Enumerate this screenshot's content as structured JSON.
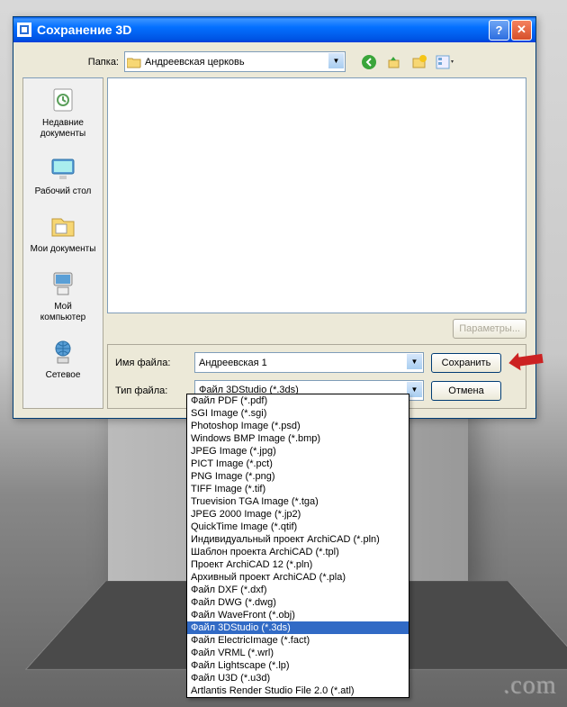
{
  "title": "Сохранение 3D",
  "folder_label": "Папка:",
  "folder_value": "Андреевская церковь",
  "places": [
    {
      "label": "Недавние документы"
    },
    {
      "label": "Рабочий стол"
    },
    {
      "label": "Мои документы"
    },
    {
      "label": "Мой\nкомпьютер"
    },
    {
      "label": "Сетевое"
    }
  ],
  "params_btn": "Параметры...",
  "filename_label": "Имя файла:",
  "filename_value": "Андреевская 1",
  "filetype_label": "Тип файла:",
  "filetype_value": "Файл 3DStudio (*.3ds)",
  "save_btn": "Сохранить",
  "cancel_btn": "Отмена",
  "dropdown": [
    {
      "t": "Файл PDF (*.pdf)"
    },
    {
      "t": "SGI Image (*.sgi)"
    },
    {
      "t": "Photoshop Image (*.psd)"
    },
    {
      "t": "Windows BMP Image (*.bmp)"
    },
    {
      "t": "JPEG Image (*.jpg)"
    },
    {
      "t": "PICT Image (*.pct)"
    },
    {
      "t": "PNG Image (*.png)"
    },
    {
      "t": "TIFF Image (*.tif)"
    },
    {
      "t": "Truevision TGA Image (*.tga)"
    },
    {
      "t": "JPEG 2000 Image (*.jp2)"
    },
    {
      "t": "QuickTime Image (*.qtif)"
    },
    {
      "t": "Индивидуальный проект ArchiCAD (*.pln)"
    },
    {
      "t": "Шаблон проекта ArchiCAD (*.tpl)"
    },
    {
      "t": "Проект ArchiCAD 12 (*.pln)"
    },
    {
      "t": "Архивный проект ArchiCAD (*.pla)"
    },
    {
      "t": "Файл DXF (*.dxf)"
    },
    {
      "t": "Файл DWG (*.dwg)"
    },
    {
      "t": "Файл WaveFront (*.obj)"
    },
    {
      "t": "Файл 3DStudio (*.3ds)",
      "sel": true
    },
    {
      "t": "Файл ElectricImage (*.fact)"
    },
    {
      "t": "Файл VRML (*.wrl)"
    },
    {
      "t": "Файл Lightscape (*.lp)"
    },
    {
      "t": "Файл U3D (*.u3d)"
    },
    {
      "t": "Artlantis Render Studio File 2.0 (*.atl)"
    }
  ],
  "watermark": ".com"
}
